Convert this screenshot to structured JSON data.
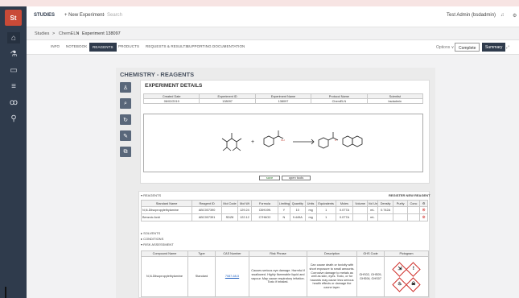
{
  "rail": {
    "logo": "St"
  },
  "topbar": {
    "app": "STUDIES",
    "new_experiment": "+ New Experiment",
    "search_placeholder": "Search",
    "user": "Test Admin (bsdadmin)"
  },
  "breadcrumb": [
    "Studies",
    ">",
    "ChemELN",
    ">",
    "Experiment 138097"
  ],
  "tabs": [
    "INFO",
    "NOTEBOOK",
    "REAGENTS",
    "PRODUCTS",
    "REQUESTS & RESULTS",
    "SUPPORTING DOCUMENTATION"
  ],
  "tab_actions": {
    "options": "Options ∨",
    "complete": "Complete",
    "summary": "Summary"
  },
  "page": {
    "title": "CHEMISTRY - REAGENTS",
    "details_title": "EXPERIMENT DETAILS"
  },
  "experiment": {
    "headers": [
      "Created Date",
      "Experiment ID",
      "Experiment Name",
      "Protocol Name",
      "Scientist"
    ],
    "row": [
      "06/02/2019",
      "138097",
      "138097",
      "ChemELN",
      "bsdadmin"
    ]
  },
  "canvas": {
    "save": "save",
    "open": "open tools"
  },
  "reagents": {
    "label": "▾ REAGENTS",
    "right_label": "REGISTER NEW REAGENT",
    "headers": [
      "Standard Name",
      "Reagent ID",
      "Mol Code",
      "Mol Wt",
      "Formula",
      "Limiting",
      "Quantity",
      "Units",
      "Equivalents",
      "Moles",
      "Volume",
      "Vol Units",
      "Density",
      "Purity",
      "Conc",
      ""
    ],
    "rows": [
      [
        "N,N-Diisopropylethylamine",
        "ABC007390",
        "",
        "129.24",
        "C8H19N",
        "Y",
        "10",
        "mg",
        "1",
        "0.077A",
        "",
        "mL",
        "0.742A",
        "",
        "",
        ""
      ],
      [
        "Benzoic Acid",
        "ABC007391",
        "SDZ8",
        "122.12",
        "C7H6O2",
        "N",
        "9.449A",
        "mg",
        "1",
        "0.077A",
        "",
        "mL",
        "",
        "",
        "",
        ""
      ]
    ]
  },
  "sections": {
    "solvents": "▸ SOLVENTS",
    "conditions": "▸ CONDITIONS",
    "risk": "▾ RISK ASSESSMENT"
  },
  "risk": {
    "headers": [
      "Compound Name",
      "Type",
      "CAS Number",
      "Risk Phrase",
      "Description",
      "GHS Code",
      "Pictogram"
    ],
    "row": [
      "N,N-Diisopropylethylamine",
      "Standard",
      "7087-68-5",
      "Causes serious eye damage. Harmful if swallowed. Highly flammable liquid and vapour. May cause respiratory irritation. Toxic if inhaled.",
      "Can cause death or toxicity with short exposure to small amounts. Corrosive damage to metals as well as skin, eyes. Toxic, or for hazards may cause less serious health effects or damage the ozone layer.",
      "GHS02, GHS05, GHS06, GHS07",
      ""
    ]
  },
  "colors": {
    "rail": "#2f3b4c",
    "accent": "#c94a37",
    "warning": "#d0312d"
  }
}
